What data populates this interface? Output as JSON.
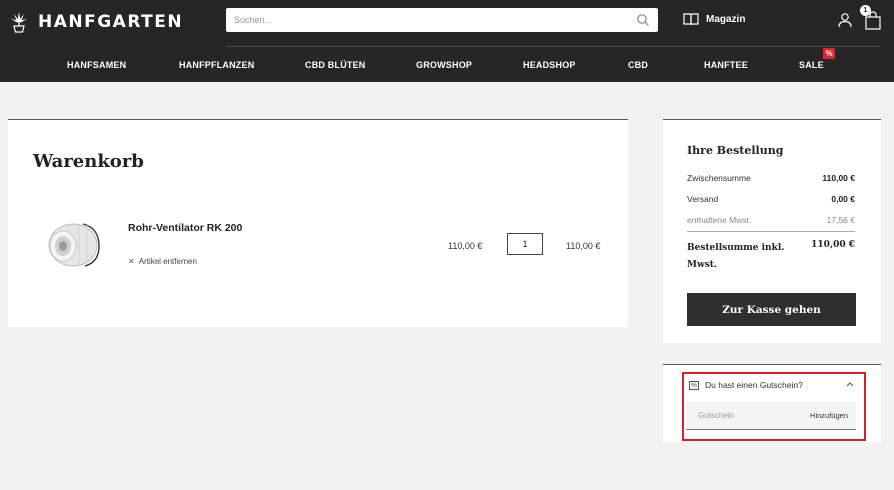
{
  "header": {
    "logo_text": "HANFGARTEN",
    "search_placeholder": "Suchen...",
    "magazin_label": "Magazin",
    "cart_count": "1"
  },
  "nav": {
    "items": [
      "HANFSAMEN",
      "HANFPFLANZEN",
      "CBD BLÜTEN",
      "GROWSHOP",
      "HEADSHOP",
      "CBD",
      "HANFTEE",
      "SALE"
    ],
    "sale_badge": "%"
  },
  "cart": {
    "title": "Warenkorb",
    "item": {
      "name": "Rohr-Ventilator RK 200",
      "remove_label": "Artikel entfernen",
      "unit_price": "110,00 €",
      "quantity": "1",
      "line_total": "110,00 €"
    }
  },
  "summary": {
    "title": "Ihre Bestellung",
    "rows": [
      {
        "label": "Zwischensumme",
        "value": "110,00 €"
      },
      {
        "label": "Versand",
        "value": "0,00 €"
      },
      {
        "label": "enthaltene Mwst.",
        "value": "17,56 €"
      }
    ],
    "total_label": "Bestellsumme inkl. Mwst.",
    "total_value": "110,00 €",
    "checkout_label": "Zur Kasse gehen"
  },
  "voucher": {
    "icon_glyph": "%",
    "heading": "Du hast einen Gutschein?",
    "placeholder": "Gutschein",
    "add_label": "Hinzufügen"
  },
  "colors": {
    "header_bg": "#262626",
    "accent_red": "#e6212a",
    "checkout_bg": "#2f2f2f"
  }
}
